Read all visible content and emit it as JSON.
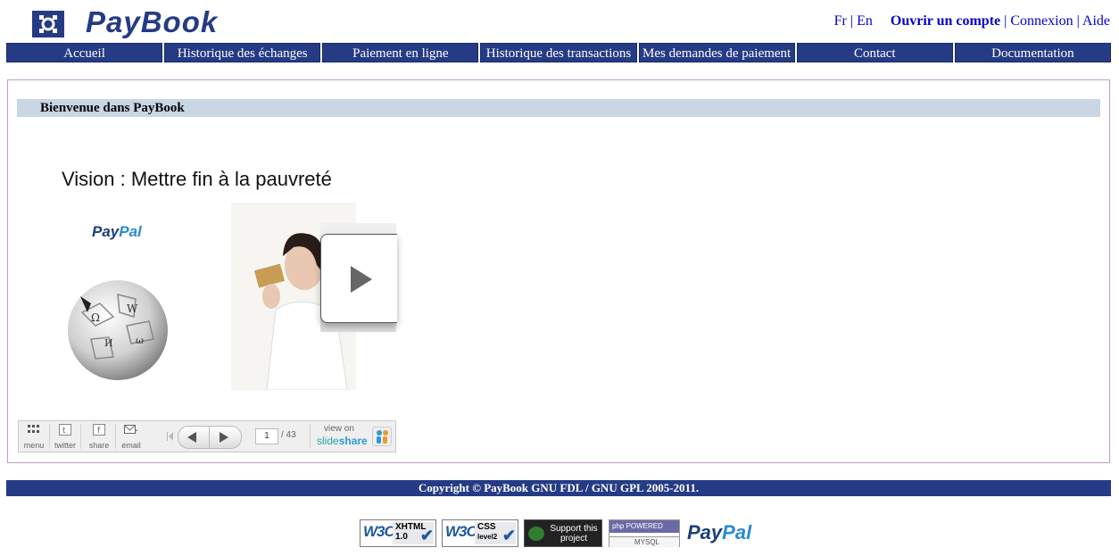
{
  "header": {
    "brand": "PayBook",
    "lang_fr": "Fr",
    "lang_sep": "|",
    "lang_en": "En",
    "open_account": "Ouvrir un compte",
    "sep": "|",
    "login": "Connexion",
    "help": "Aide",
    "colors": {
      "primary": "#263b85",
      "link": "#0000cc"
    }
  },
  "nav": {
    "items": [
      "Accueil",
      "Historique des échanges",
      "Paiement en ligne",
      "Historique des transactions",
      "Mes demandes de paiement",
      "Contact",
      "Documentation"
    ]
  },
  "main": {
    "welcome": "Bienvenue dans PayBook",
    "slideshow": {
      "slide_title": "Vision : Mettre fin à la pauvreté",
      "paypal_pay": "Pay",
      "paypal_pal": "Pal",
      "controls": {
        "menu": "menu",
        "twitter": "twitter",
        "share": "share",
        "email": "email",
        "current_page": "1",
        "total_pages": "/ 43",
        "view_on": "view on",
        "slideshare_a": "slide",
        "slideshare_b": "share"
      }
    }
  },
  "footer": {
    "copyright": "Copyright © PayBook GNU FDL / GNU GPL 2005-2011.",
    "badges": {
      "xhtml": [
        "XHTML",
        "1.0"
      ],
      "css": [
        "CSS",
        "level2"
      ],
      "support": [
        "Support this",
        "project"
      ],
      "php": "php POWERED",
      "mysql": "MYSQL",
      "paypal_pay": "Pay",
      "paypal_pal": "Pal"
    }
  }
}
